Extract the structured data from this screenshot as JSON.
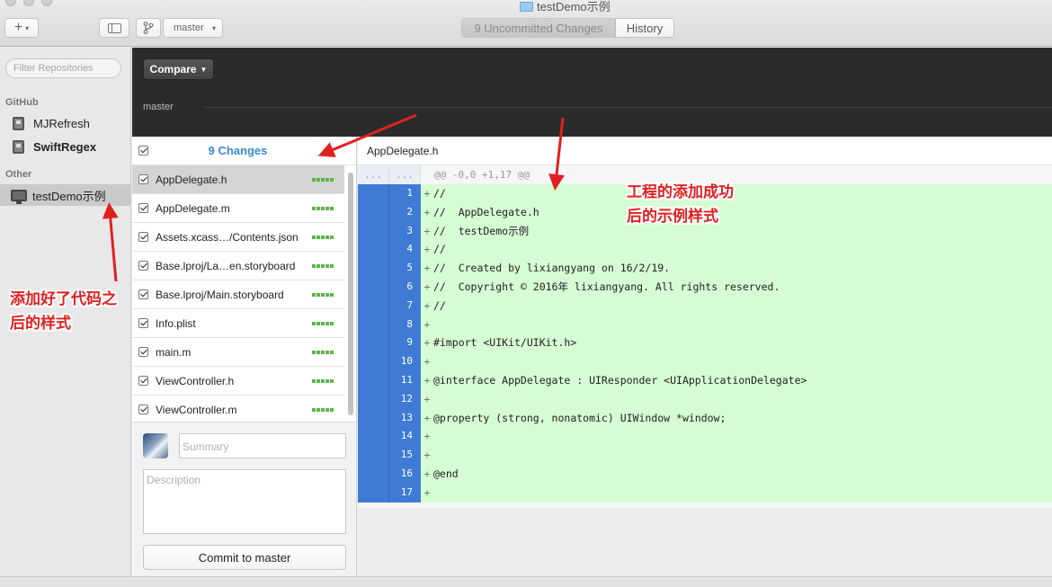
{
  "window": {
    "title": "testDemo示例"
  },
  "toolbar": {
    "add_label": "+",
    "branch_name": "master",
    "tabs": [
      {
        "label": "9 Uncommitted Changes",
        "active": true
      },
      {
        "label": "History",
        "active": false
      }
    ]
  },
  "sidebar": {
    "filter_placeholder": "Filter Repositories",
    "sections": [
      {
        "title": "GitHub",
        "repos": [
          {
            "name": "MJRefresh"
          },
          {
            "name": "SwiftRegex"
          }
        ]
      },
      {
        "title": "Other",
        "repos": [
          {
            "name": "testDemo示例",
            "selected": true
          }
        ]
      }
    ]
  },
  "compare": {
    "button_label": "Compare",
    "branch": "master"
  },
  "changes": {
    "title": "9 Changes",
    "files": [
      {
        "name": "AppDelegate.h",
        "selected": true
      },
      {
        "name": "AppDelegate.m"
      },
      {
        "name": "Assets.xcass…/Contents.json"
      },
      {
        "name": "Base.lproj/La…en.storyboard"
      },
      {
        "name": "Base.lproj/Main.storyboard"
      },
      {
        "name": "Info.plist"
      },
      {
        "name": "main.m"
      },
      {
        "name": "ViewController.h"
      },
      {
        "name": "ViewController.m"
      }
    ]
  },
  "commit": {
    "summary_placeholder": "Summary",
    "description_placeholder": "Description",
    "button_label": "Commit to master"
  },
  "diff": {
    "file": "AppDelegate.h",
    "hunk_gutter": "...",
    "hunk_header": "@@ -0,0 +1,17 @@",
    "lines": [
      {
        "num": "1",
        "text": "//"
      },
      {
        "num": "2",
        "text": "//  AppDelegate.h"
      },
      {
        "num": "3",
        "text": "//  testDemo示例"
      },
      {
        "num": "4",
        "text": "//"
      },
      {
        "num": "5",
        "text": "//  Created by lixiangyang on 16/2/19."
      },
      {
        "num": "6",
        "text": "//  Copyright © 2016年 lixiangyang. All rights reserved."
      },
      {
        "num": "7",
        "text": "//"
      },
      {
        "num": "8",
        "text": ""
      },
      {
        "num": "9",
        "text": "#import <UIKit/UIKit.h>"
      },
      {
        "num": "10",
        "text": ""
      },
      {
        "num": "11",
        "text": "@interface AppDelegate : UIResponder <UIApplicationDelegate>"
      },
      {
        "num": "12",
        "text": ""
      },
      {
        "num": "13",
        "text": "@property (strong, nonatomic) UIWindow *window;"
      },
      {
        "num": "14",
        "text": ""
      },
      {
        "num": "15",
        "text": ""
      },
      {
        "num": "16",
        "text": "@end"
      },
      {
        "num": "17",
        "text": ""
      }
    ]
  },
  "annotations": {
    "left_line1": "添加好了代码之",
    "left_line2": "后的样式",
    "right_line1": "工程的添加成功",
    "right_line2": "后的示例样式"
  },
  "colors": {
    "accent": "#3a8ad1",
    "added_bg": "#d6fcd4",
    "gutter": "#3f7bd4",
    "annotation": "#e02020"
  }
}
